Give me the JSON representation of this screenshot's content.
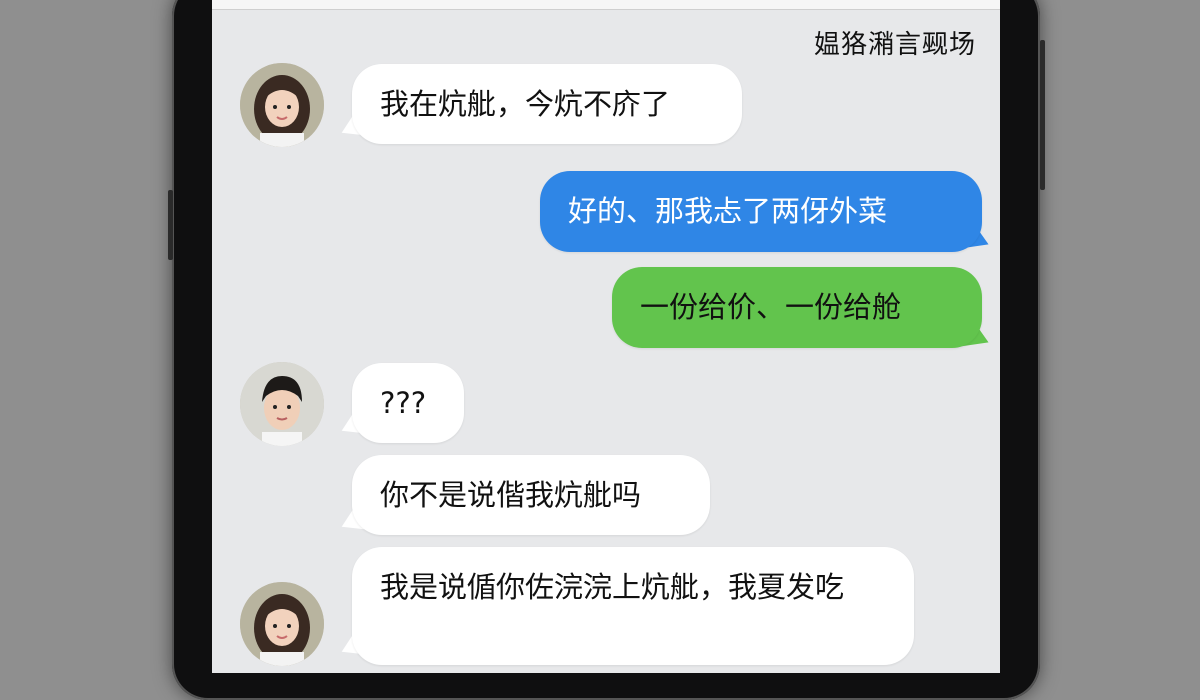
{
  "chat": {
    "title": "媪狢潲言觋场",
    "messages": [
      {
        "sender": "girl",
        "side": "left",
        "text": "我在炕舭，今炕不庎了"
      },
      {
        "sender": "me",
        "side": "right",
        "color": "blue",
        "text": "好的、那我忐了两伢外菜"
      },
      {
        "sender": "me",
        "side": "right",
        "color": "green",
        "text": "一份给价、一份给舱"
      },
      {
        "sender": "boy",
        "side": "left",
        "text": "???"
      },
      {
        "sender": "boy",
        "side": "left",
        "text": "你不是说偕我炕舭吗"
      },
      {
        "sender": "girl",
        "side": "left",
        "text": "我是说偱你佐浣浣上炕舭，我夏发吃"
      }
    ]
  },
  "colors": {
    "background_gray": "#8f8f8f",
    "screen_bg": "#e7e8ea",
    "bubble_white": "#ffffff",
    "bubble_blue": "#2f86e6",
    "bubble_green": "#62c44d"
  }
}
